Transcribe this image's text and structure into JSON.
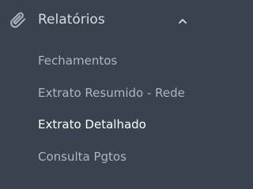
{
  "colors": {
    "background": "#39424e",
    "header_text": "#d7dbe0",
    "item_text": "#aeb6c0",
    "active_text": "#ffffff"
  },
  "section": {
    "title": "Relatórios",
    "icon": "paperclip-icon",
    "toggle_icon": "chevron-up-icon",
    "expanded": true
  },
  "submenu": {
    "items": [
      {
        "label": "Fechamentos",
        "active": false
      },
      {
        "label": "Extrato Resumido - Rede",
        "active": false
      },
      {
        "label": "Extrato Detalhado",
        "active": true
      },
      {
        "label": "Consulta Pgtos",
        "active": false
      }
    ]
  }
}
